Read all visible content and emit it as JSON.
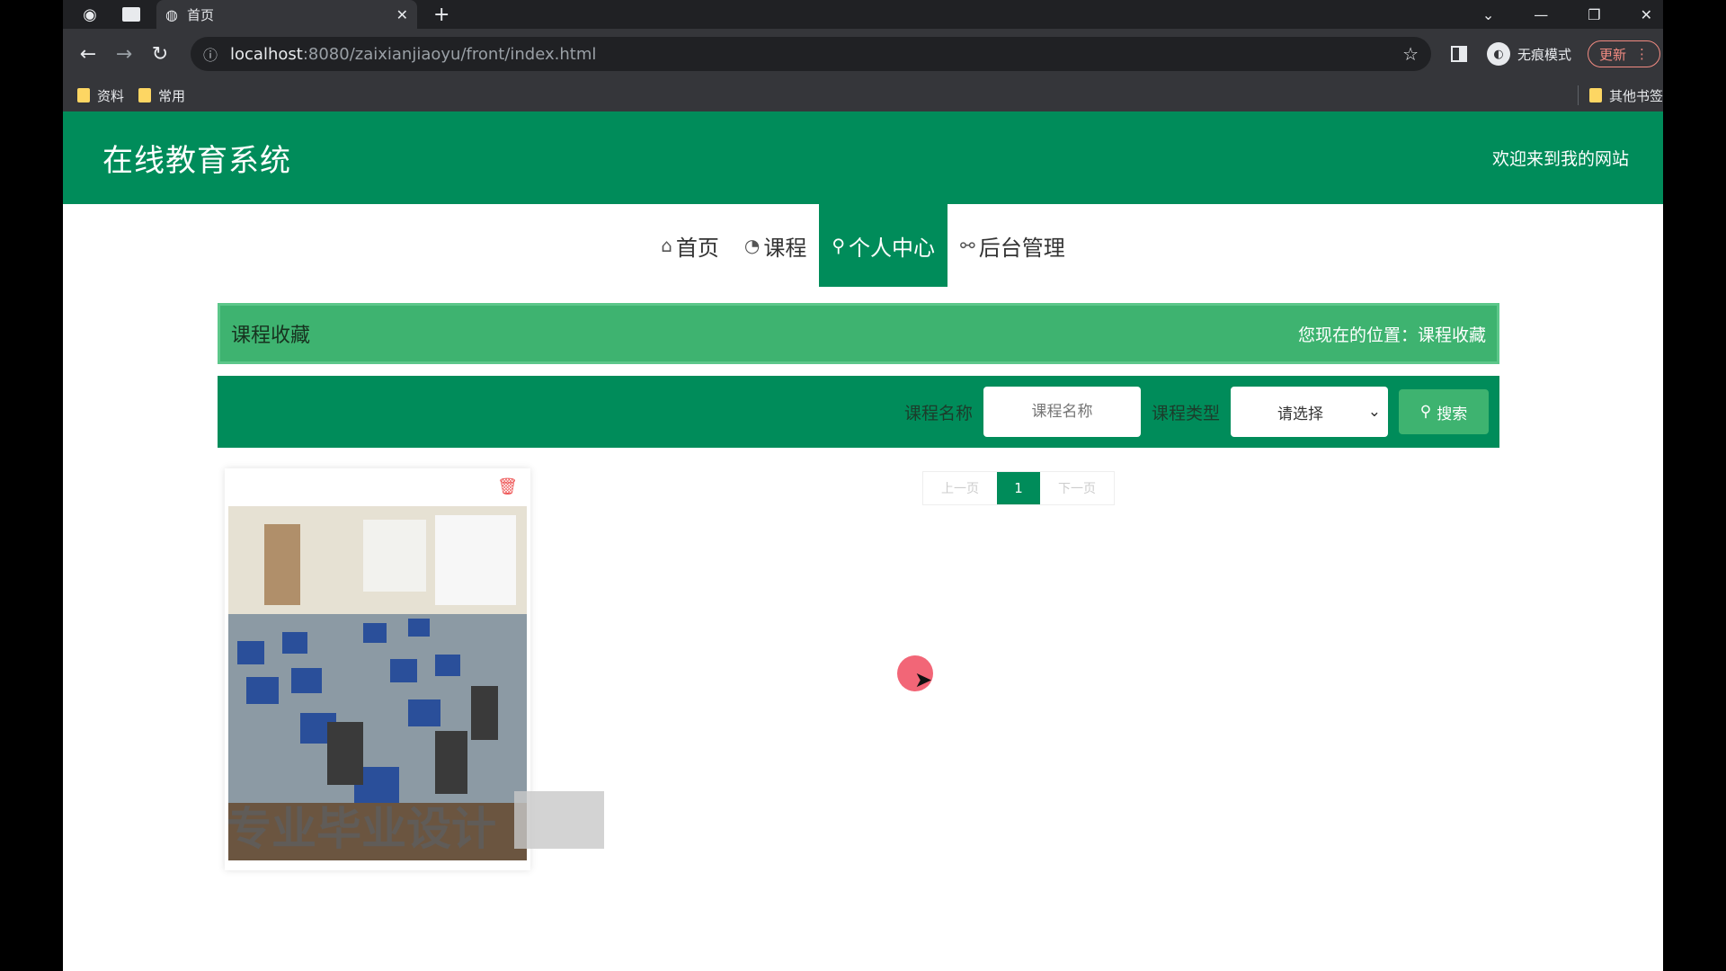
{
  "browser": {
    "tab_title": "首页",
    "url_host": "localhost",
    "url_path": ":8080/zaixianjiaoyu/front/index.html",
    "incognito_label": "无痕模式",
    "update_label": "更新",
    "bookmarks": [
      "资料",
      "常用"
    ],
    "bookmarks_other": "其他书签"
  },
  "header": {
    "title": "在线教育系统",
    "welcome": "欢迎来到我的网站"
  },
  "nav": [
    {
      "label": "首页",
      "icon": "home-icon"
    },
    {
      "label": "课程",
      "icon": "gauge-icon"
    },
    {
      "label": "个人中心",
      "icon": "user-icon"
    },
    {
      "label": "后台管理",
      "icon": "link-icon"
    }
  ],
  "breadcrumb": {
    "title": "课程收藏",
    "location_prefix": "您现在的位置：",
    "location": "课程收藏"
  },
  "search": {
    "name_label": "课程名称",
    "name_placeholder": "课程名称",
    "type_label": "课程类型",
    "type_selected": "请选择",
    "button_label": "搜索"
  },
  "card": {
    "caption": "专业毕业设计"
  },
  "pager": {
    "prev": "上一页",
    "current": "1",
    "next": "下一页"
  },
  "colors": {
    "primary": "#008c5a",
    "light": "#3eb370"
  }
}
